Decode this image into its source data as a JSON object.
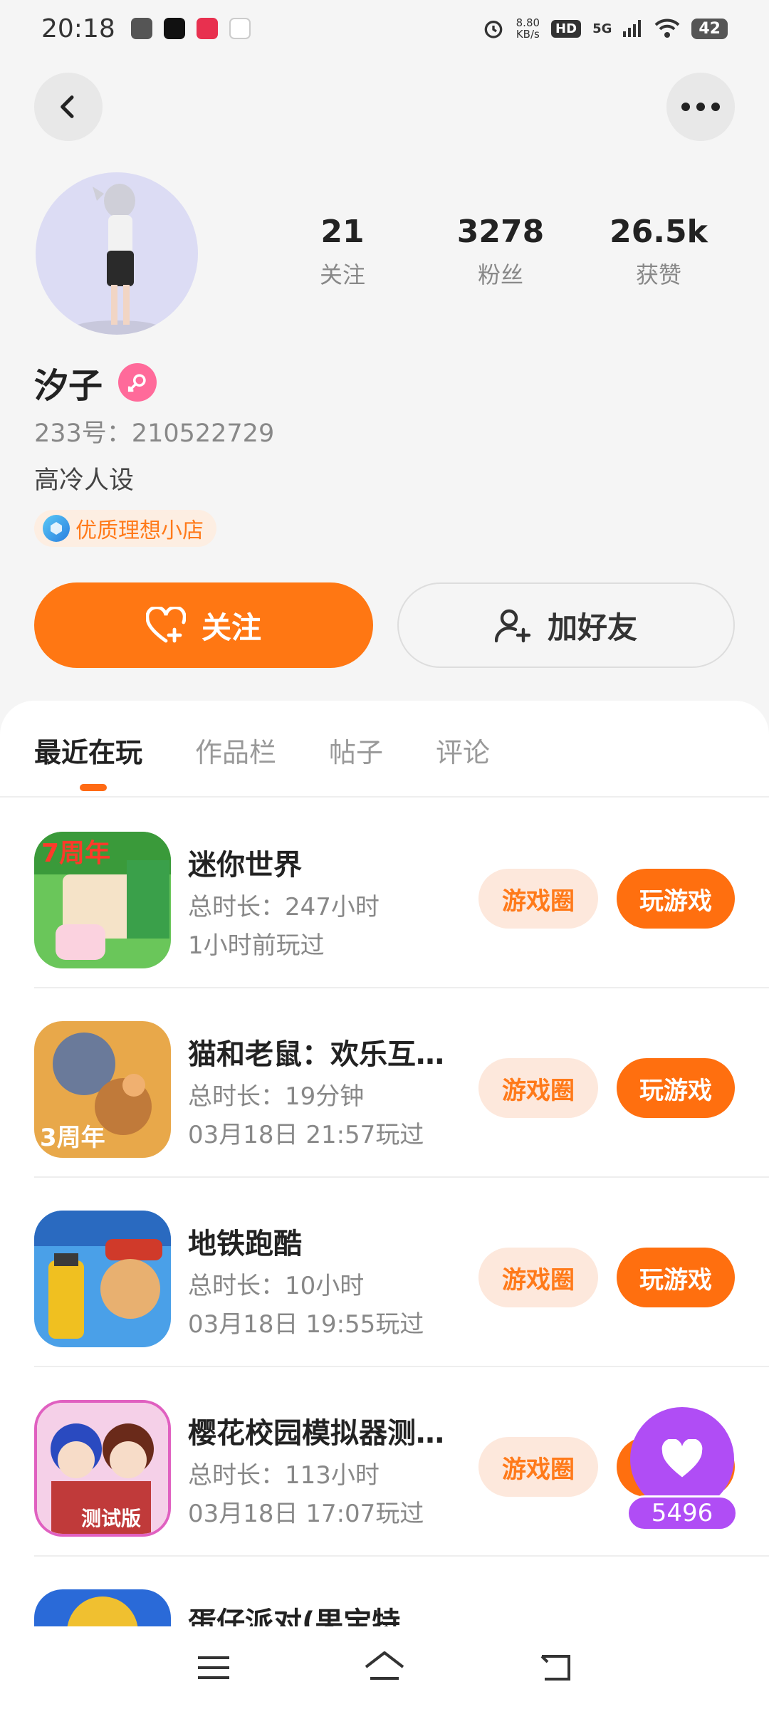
{
  "status": {
    "time": "20:18",
    "speed_value": "8.80",
    "speed_unit": "KB/s",
    "hd": "HD",
    "network": "5G",
    "battery": "42"
  },
  "profile": {
    "name": "汐子",
    "uid": "233号：210522729",
    "bio": "高冷人设",
    "shop_badge": "优质理想小店",
    "stats": [
      {
        "value": "21",
        "label": "关注"
      },
      {
        "value": "3278",
        "label": "粉丝"
      },
      {
        "value": "26.5k",
        "label": "获赞"
      }
    ]
  },
  "actions": {
    "follow_label": "关注",
    "add_friend_label": "加好友"
  },
  "tabs": [
    {
      "label": "最近在玩",
      "active": true
    },
    {
      "label": "作品栏",
      "active": false
    },
    {
      "label": "帖子",
      "active": false
    },
    {
      "label": "评论",
      "active": false
    }
  ],
  "games": [
    {
      "title": "迷你世界",
      "duration": "总时长：247小时",
      "last_played": "1小时前玩过",
      "circle_label": "游戏圈",
      "play_label": "玩游戏"
    },
    {
      "title": "猫和老鼠：欢乐互…",
      "duration": "总时长：19分钟",
      "last_played": "03月18日 21:57玩过",
      "circle_label": "游戏圈",
      "play_label": "玩游戏"
    },
    {
      "title": "地铁跑酷",
      "duration": "总时长：10小时",
      "last_played": "03月18日 19:55玩过",
      "circle_label": "游戏圈",
      "play_label": "玩游戏"
    },
    {
      "title": "樱花校园模拟器测…",
      "duration": "总时长：113小时",
      "last_played": "03月18日 17:07玩过",
      "circle_label": "游戏圈",
      "play_label": "玩游戏"
    },
    {
      "title": "蛋仔派对(果宝特…",
      "duration": "",
      "last_played": "",
      "circle_label": "",
      "play_label": ""
    }
  ],
  "floating_like": {
    "count": "5496"
  },
  "colors": {
    "accent": "#ff7713",
    "like_purple": "#b04df5",
    "badge_bg": "#fdeee2"
  }
}
